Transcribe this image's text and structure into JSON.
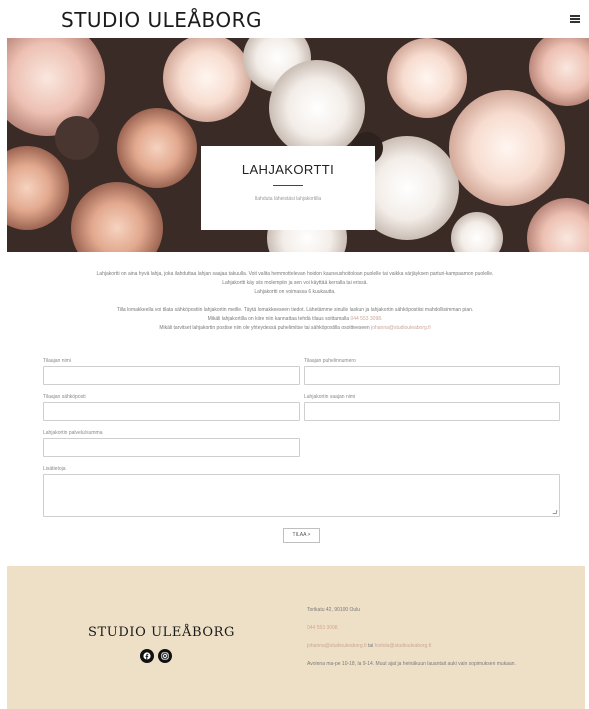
{
  "header": {
    "brand": "STUDIO ULEÅBORG",
    "menu_icon": "hamburger-icon"
  },
  "hero": {
    "title": "LAHJAKORTTI",
    "subtitle": "Ilahduta läheistäsi lahjakortilla"
  },
  "intro": {
    "line1": "Lahjakortti on aina hyvä lahja, joka ilahduttaa lahjan saajaa takuulla. Voit valita hemmottelevan hoidon kauneushoitoloan puolelle tai vaikka värjäyksen parturi-kampaamon puolelle.",
    "line2": "Lahjakortti käy siis molempiin ja sen voi käyttää kerralla tai erissä.",
    "line3": "Lahjakortti on voimassa 6 kuukautta.",
    "line4": "Tilla lomakkeella voi tilata sähköpostiin lahjakortin meille. Täytä lomakkeeseen tiedot. Lähetämme sinulle laskun ja lahjakortin sähköpostiisi mahdollisimman pian.",
    "line5_prefix": "Mikäli lahjakortilla on kiire niin kannattaa tehdä tilaus soittamalla ",
    "line5_phone": "044 553 3098.",
    "line6_prefix": "Mikäli tarvitset lahjakortin postise niin ole yhteydessä puhelimitse tai sähköpostilla osoitteeseen ",
    "line6_email": "johanna@studiouleaborg.fi"
  },
  "form": {
    "orderer_name_label": "Tilaajan nimi",
    "orderer_phone_label": "Tilaajan puhelinnumero",
    "orderer_email_label": "Tilaajan sähköposti",
    "recipient_name_label": "Lahjakortin saajan nimi",
    "service_amount_label": "Lahjakortin palvelu/summa",
    "details_label": "Lisätietoja",
    "submit_label": "TILAA >"
  },
  "footer": {
    "brand": "STUDIO ULEÅBORG",
    "address": "Torikatu 42, 90100 Oulu",
    "phone": "044 553 3098",
    "email1": "johanna@studiouleaborg.fi",
    "email_sep": " tai ",
    "email2": "hoitola@studiouleaborg.fi",
    "hours": "Avoinna ma-pe 10-18, la 9-14. Muut ajat ja heinäkuun lauantait auki vain sopimuksen mukaan.",
    "social_icons": [
      "facebook-icon",
      "instagram-icon"
    ]
  },
  "colors": {
    "footer_bg": "#eee0c6",
    "accent": "#d7a58f"
  }
}
